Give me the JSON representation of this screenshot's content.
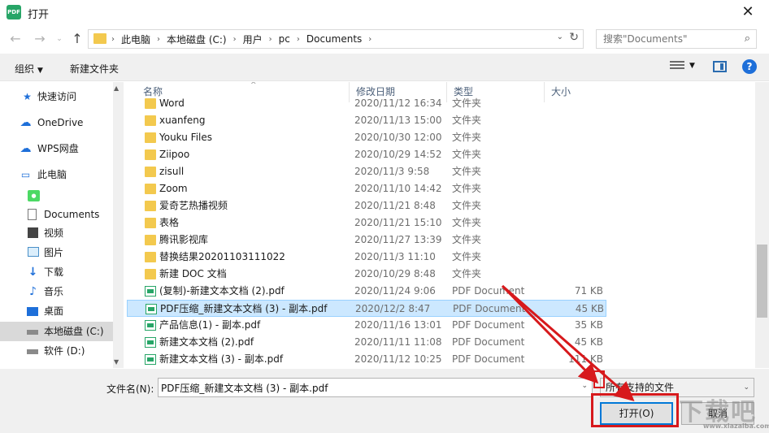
{
  "window": {
    "title": "打开",
    "app_icon_text": "PDF"
  },
  "address": {
    "crumbs": [
      "此电脑",
      "本地磁盘 (C:)",
      "用户",
      "pc",
      "Documents"
    ],
    "search_placeholder": "搜索\"Documents\""
  },
  "toolbar": {
    "organize": "组织",
    "new_folder": "新建文件夹"
  },
  "sidebar": {
    "items": [
      {
        "label": "快速访问",
        "icon": "star-icon"
      },
      {
        "label": "OneDrive",
        "icon": "cloud-icon"
      },
      {
        "label": "WPS网盘",
        "icon": "cloud-icon"
      },
      {
        "label": "此电脑",
        "icon": "computer-icon"
      },
      {
        "label": "",
        "icon": "app-icon"
      },
      {
        "label": "Documents",
        "icon": "document-icon"
      },
      {
        "label": "视频",
        "icon": "video-icon"
      },
      {
        "label": "图片",
        "icon": "picture-icon"
      },
      {
        "label": "下载",
        "icon": "download-icon"
      },
      {
        "label": "音乐",
        "icon": "music-icon"
      },
      {
        "label": "桌面",
        "icon": "desktop-icon"
      },
      {
        "label": "本地磁盘 (C:)",
        "icon": "drive-icon",
        "selected": true
      },
      {
        "label": "软件 (D:)",
        "icon": "drive-icon"
      }
    ]
  },
  "columns": {
    "name": "名称",
    "date": "修改日期",
    "type": "类型",
    "size": "大小"
  },
  "files": [
    {
      "name": "Word",
      "date": "2020/11/12 16:34",
      "type": "文件夹",
      "size": "",
      "kind": "folder"
    },
    {
      "name": "xuanfeng",
      "date": "2020/11/13 15:00",
      "type": "文件夹",
      "size": "",
      "kind": "folder"
    },
    {
      "name": "Youku Files",
      "date": "2020/10/30 12:00",
      "type": "文件夹",
      "size": "",
      "kind": "folder"
    },
    {
      "name": "Ziipoo",
      "date": "2020/10/29 14:52",
      "type": "文件夹",
      "size": "",
      "kind": "folder"
    },
    {
      "name": "zisull",
      "date": "2020/11/3 9:58",
      "type": "文件夹",
      "size": "",
      "kind": "folder"
    },
    {
      "name": "Zoom",
      "date": "2020/11/10 14:42",
      "type": "文件夹",
      "size": "",
      "kind": "folder"
    },
    {
      "name": "爱奇艺热播视频",
      "date": "2020/11/21 8:48",
      "type": "文件夹",
      "size": "",
      "kind": "folder"
    },
    {
      "name": "表格",
      "date": "2020/11/21 15:10",
      "type": "文件夹",
      "size": "",
      "kind": "folder"
    },
    {
      "name": "腾讯影视库",
      "date": "2020/11/27 13:39",
      "type": "文件夹",
      "size": "",
      "kind": "folder"
    },
    {
      "name": "替换结果20201103111022",
      "date": "2020/11/3 11:10",
      "type": "文件夹",
      "size": "",
      "kind": "folder"
    },
    {
      "name": "新建 DOC 文档",
      "date": "2020/10/29 8:48",
      "type": "文件夹",
      "size": "",
      "kind": "folder"
    },
    {
      "name": "(复制)-新建文本文档 (2).pdf",
      "date": "2020/11/24 9:06",
      "type": "PDF Document",
      "size": "71 KB",
      "kind": "pdf"
    },
    {
      "name": "PDF压缩_新建文本文档 (3) - 副本.pdf",
      "date": "2020/12/2 8:47",
      "type": "PDF Document",
      "size": "45 KB",
      "kind": "pdf",
      "selected": true
    },
    {
      "name": "产品信息(1) - 副本.pdf",
      "date": "2020/11/16 13:01",
      "type": "PDF Document",
      "size": "35 KB",
      "kind": "pdf"
    },
    {
      "name": "新建文本文档 (2).pdf",
      "date": "2020/11/11 11:08",
      "type": "PDF Document",
      "size": "45 KB",
      "kind": "pdf"
    },
    {
      "name": "新建文本文档 (3) - 副本.pdf",
      "date": "2020/11/12 10:25",
      "type": "PDF Document",
      "size": "111 KB",
      "kind": "pdf"
    }
  ],
  "bottom": {
    "filename_label": "文件名(N):",
    "filename_value": "PDF压缩_新建文本文档 (3) - 副本.pdf",
    "filetype": "所有支持的文件",
    "open": "打开(O)",
    "cancel": "取消"
  },
  "watermark": {
    "main": "下载吧",
    "sub": "www.xiazaiba.com"
  },
  "colors": {
    "accent": "#0078d7",
    "highlight": "#d7191c",
    "selection": "#cce8ff",
    "folder": "#f3c94e",
    "pdf": "#27a567"
  }
}
